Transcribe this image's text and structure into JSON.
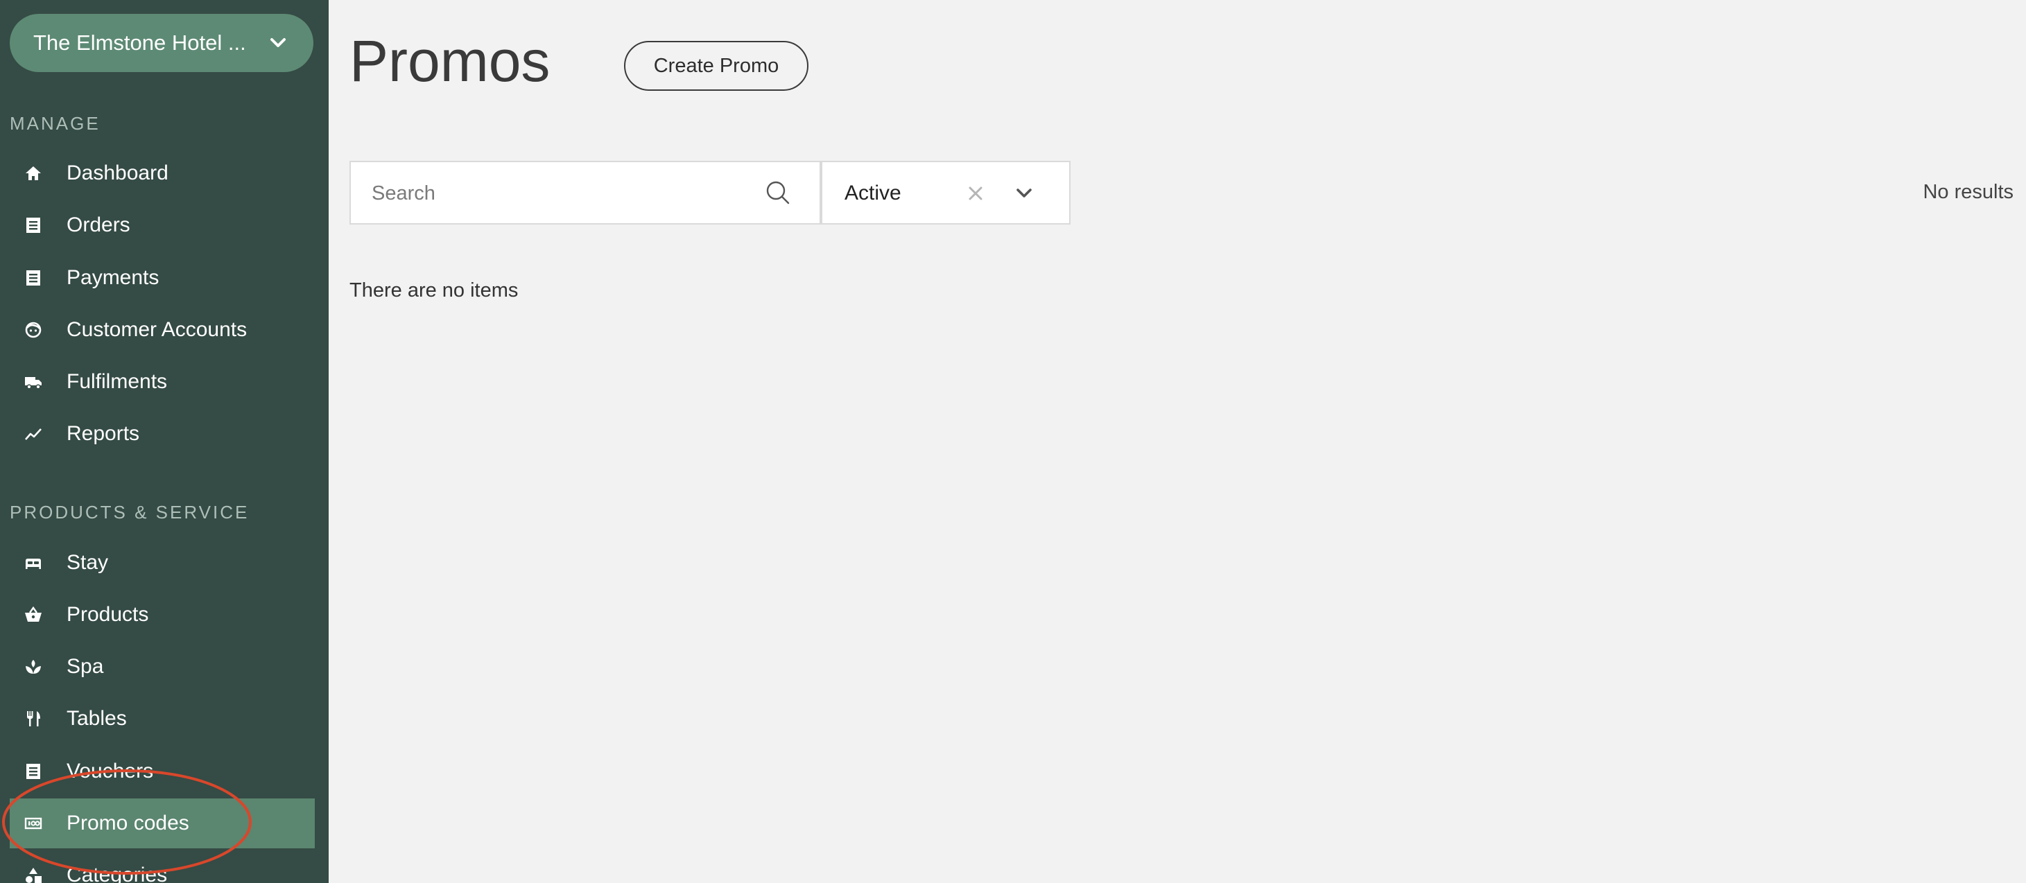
{
  "sidebar": {
    "venue_name": "The Elmstone Hotel ...",
    "sections": {
      "manage": "MANAGE",
      "products_service": "PRODUCTS & SERVICE"
    },
    "manage_items": [
      {
        "label": "Dashboard",
        "icon": "home-icon"
      },
      {
        "label": "Orders",
        "icon": "list-icon"
      },
      {
        "label": "Payments",
        "icon": "list-icon"
      },
      {
        "label": "Customer Accounts",
        "icon": "face-icon"
      },
      {
        "label": "Fulfilments",
        "icon": "truck-icon"
      },
      {
        "label": "Reports",
        "icon": "trend-icon"
      }
    ],
    "product_items": [
      {
        "label": "Stay",
        "icon": "bed-icon"
      },
      {
        "label": "Products",
        "icon": "basket-icon"
      },
      {
        "label": "Spa",
        "icon": "spa-icon"
      },
      {
        "label": "Tables",
        "icon": "cutlery-icon"
      },
      {
        "label": "Vouchers",
        "icon": "list-icon"
      },
      {
        "label": "Promo codes",
        "icon": "promo-icon",
        "active": true
      },
      {
        "label": "Categories",
        "icon": "categories-icon"
      }
    ],
    "accent_color": "#5b8670",
    "background_color": "#354b45"
  },
  "main": {
    "title": "Promos",
    "create_button": "Create Promo",
    "search": {
      "placeholder": "Search",
      "value": ""
    },
    "status_filter": {
      "value": "Active"
    },
    "results_label": "No results",
    "empty_message": "There are no items"
  },
  "annotation": {
    "color": "#d9472b",
    "shape": "ellipse"
  }
}
